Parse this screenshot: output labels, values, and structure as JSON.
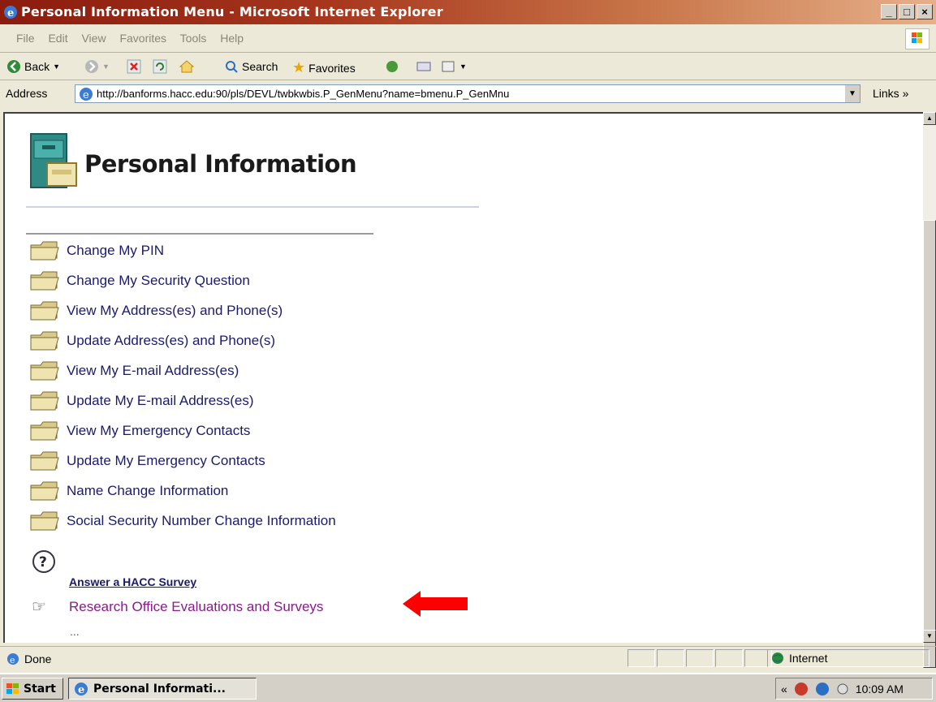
{
  "window": {
    "title": "Personal Information Menu - Microsoft Internet Explorer",
    "controls": [
      "_",
      "□",
      "×"
    ]
  },
  "menubar": {
    "items": [
      "File",
      "Edit",
      "View",
      "Favorites",
      "Tools",
      "Help"
    ]
  },
  "toolbar": {
    "back_label": "Back",
    "search_label": "Search",
    "favorites_label": "Favorites"
  },
  "addressbar": {
    "label": "Address",
    "url": "http://banforms.hacc.edu:90/pls/DEVL/twbkwbis.P_GenMenu?name=bmenu.P_GenMnu",
    "links_label": "Links »"
  },
  "page": {
    "title": "Personal Information",
    "menu_items": [
      "Change My PIN",
      "Change My Security Question",
      "View My Address(es) and Phone(s)",
      "Update Address(es) and Phone(s)",
      "View My E-mail Address(es)",
      "Update My E-mail Address(es)",
      "View My Emergency Contacts",
      "Update My Emergency Contacts",
      "Name Change Information",
      "Social Security Number Change Information"
    ],
    "survey_label": "Answer a HACC Survey",
    "research_label": "Research Office Evaluations and Surveys",
    "more_indicator": "..."
  },
  "statusbar": {
    "status": "Done",
    "zone": "Internet"
  },
  "taskbar": {
    "start_label": "Start",
    "task_label": "Personal Informati...",
    "clock": "10:09 AM"
  },
  "colors": {
    "link": "#1a1a6e",
    "visited": "#8b1a8b",
    "arrow": "#ff0000",
    "title_bar": "#a7361d"
  }
}
